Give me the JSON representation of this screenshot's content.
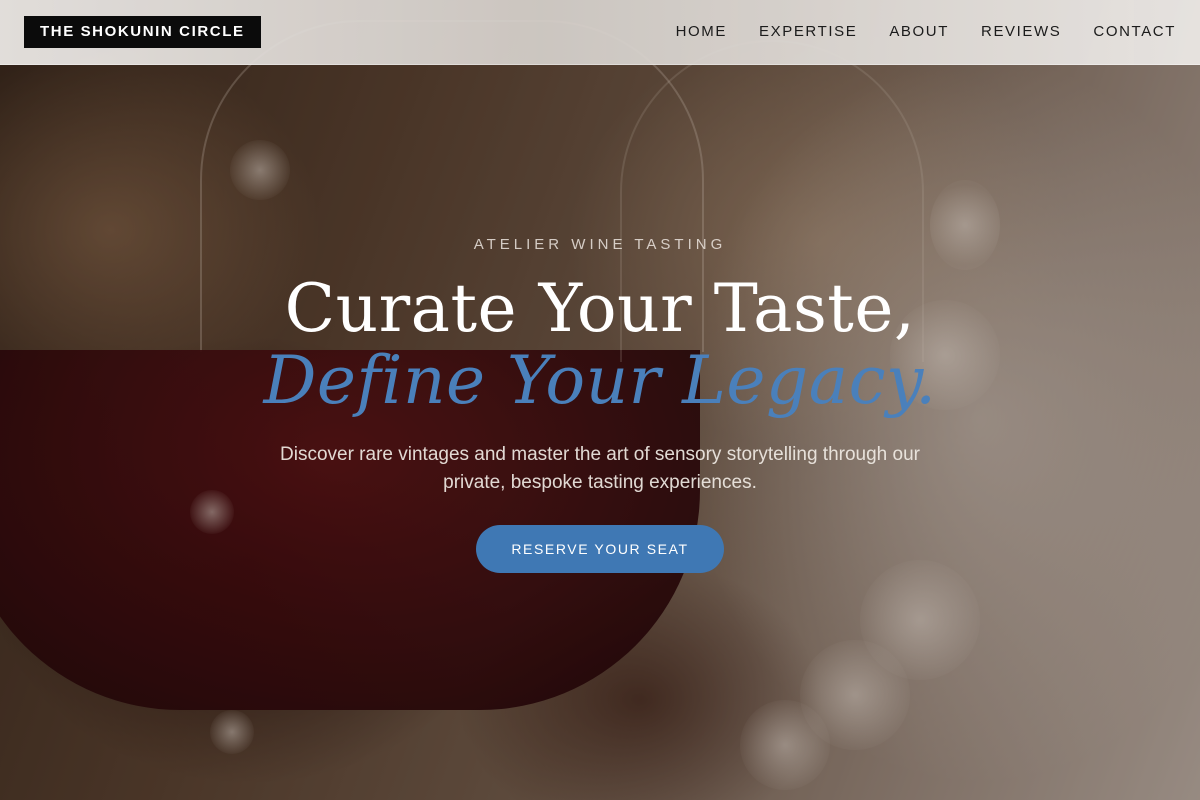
{
  "brand": {
    "name": "THE SHOKUNIN CIRCLE"
  },
  "nav": {
    "items": [
      {
        "label": "HOME"
      },
      {
        "label": "EXPERTISE"
      },
      {
        "label": "ABOUT"
      },
      {
        "label": "REVIEWS"
      },
      {
        "label": "CONTACT"
      }
    ]
  },
  "hero": {
    "eyebrow": "ATELIER WINE TASTING",
    "headline_line1": "Curate Your Taste,",
    "headline_line2": "Define Your Legacy.",
    "description": "Discover rare vintages and master the art of sensory storytelling through our private, bespoke tasting experiences.",
    "cta_label": "RESERVE YOUR SEAT"
  },
  "colors": {
    "accent": "#4a80bb",
    "button": "#3f78b4",
    "brand_bg": "#0b0b0b"
  }
}
